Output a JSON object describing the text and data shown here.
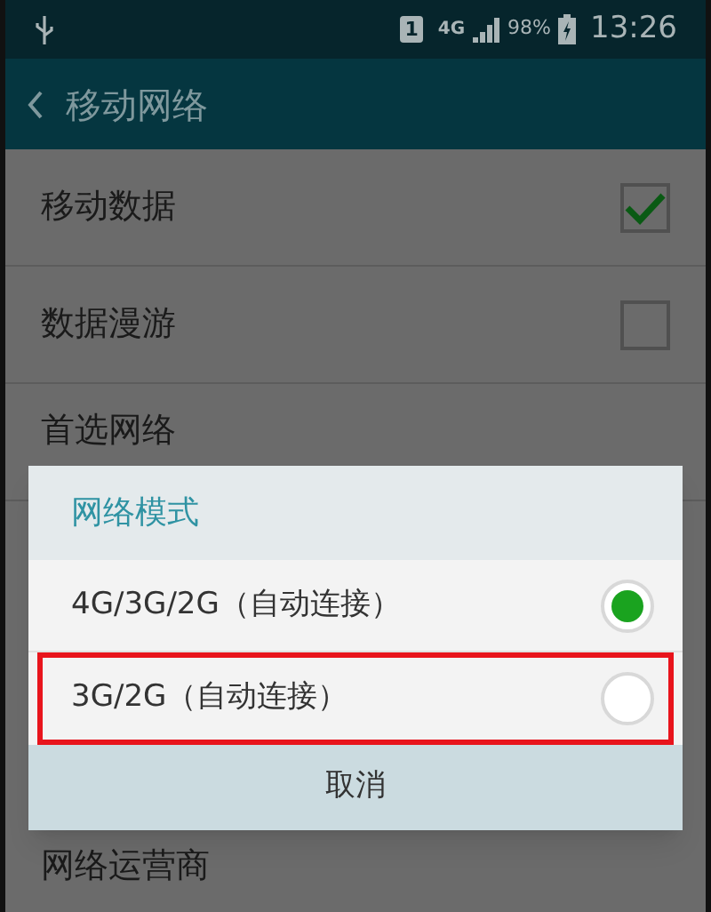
{
  "status_bar": {
    "sim": "1",
    "network": "4G",
    "battery": "98%",
    "time": "13:26"
  },
  "header": {
    "title": "移动网络"
  },
  "settings": [
    {
      "label": "移动数据",
      "kind": "checkbox",
      "checked": true
    },
    {
      "label": "数据漫游",
      "kind": "checkbox",
      "checked": false
    },
    {
      "label": "首选网络",
      "kind": "plain"
    }
  ],
  "dialog": {
    "title": "网络模式",
    "options": [
      {
        "label": "4G/3G/2G（自动连接）",
        "selected": true,
        "highlighted": false
      },
      {
        "label": "3G/2G（自动连接）",
        "selected": false,
        "highlighted": true
      }
    ],
    "cancel": "取消"
  },
  "bottom_item": {
    "label": "网络运营商"
  }
}
